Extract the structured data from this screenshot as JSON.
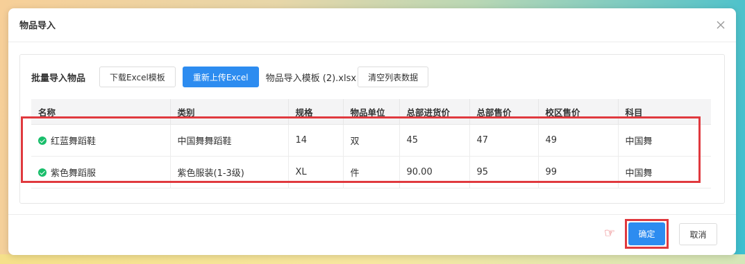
{
  "dialog": {
    "title": "物品导入",
    "close_icon": "close-icon"
  },
  "toolbar": {
    "label": "批量导入物品",
    "download_label": "下载Excel模板",
    "reupload_label": "重新上传Excel",
    "filename": "物品导入模板 (2).xlsx",
    "clear_label": "清空列表数据"
  },
  "table": {
    "headers": [
      "名称",
      "类别",
      "规格",
      "物品单位",
      "总部进货价",
      "总部售价",
      "校区售价",
      "科目"
    ],
    "rows": [
      [
        "红蓝舞蹈鞋",
        "中国舞舞蹈鞋",
        "14",
        "双",
        "45",
        "47",
        "49",
        "中国舞"
      ],
      [
        "紫色舞蹈服",
        "紫色服装(1-3级)",
        "XL",
        "件",
        "90.00",
        "95",
        "99",
        "中国舞"
      ]
    ]
  },
  "footer": {
    "pointer_glyph": "☞",
    "ok_label": "确定",
    "cancel_label": "取消"
  },
  "colors": {
    "primary": "#2d8cf0",
    "success": "#19be6b",
    "highlight": "#e0393e"
  }
}
